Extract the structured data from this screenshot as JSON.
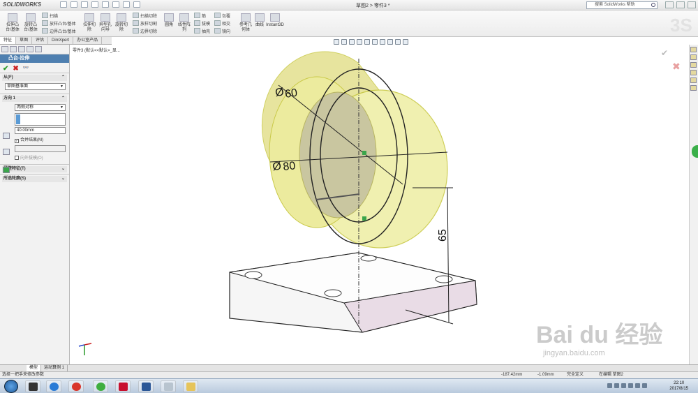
{
  "app": {
    "logo_brand": "SOLIDWORKS",
    "window_title": "草图2 > 零件3 *",
    "search_placeholder": "搜索 SolidWorks 帮助"
  },
  "ribbon": {
    "big_buttons": [
      {
        "label": "拉伸凸\n台/基体",
        "icon": "extrude-boss-icon"
      },
      {
        "label": "旋转凸\n台/基体",
        "icon": "revolve-boss-icon"
      },
      {
        "label": "拉伸切\n除",
        "icon": "extrude-cut-icon"
      },
      {
        "label": "异型孔\n向导",
        "icon": "hole-wizard-icon"
      },
      {
        "label": "旋转切\n除",
        "icon": "revolve-cut-icon"
      },
      {
        "label": "圆角",
        "icon": "fillet-icon"
      },
      {
        "label": "线性阵\n列",
        "icon": "linear-pattern-icon"
      },
      {
        "label": "参考几\n何体",
        "icon": "reference-geometry-icon"
      },
      {
        "label": "曲线",
        "icon": "curves-icon"
      },
      {
        "label": "Instant3D",
        "icon": "instant3d-icon"
      }
    ],
    "small_buttons": {
      "sweep": "扫描",
      "loft": "放样凸台/基体",
      "boundary": "边界凸台/基体",
      "sweep_cut": "扫描切除",
      "loft_cut": "放样切割",
      "boundary_cut": "边界切除",
      "rib": "筋",
      "draft": "拔模",
      "shell": "抽壳",
      "wrap": "包覆",
      "intersect": "相交",
      "mirror": "镜向"
    }
  },
  "tabs": [
    {
      "label": "特征",
      "active": true
    },
    {
      "label": "草图",
      "active": false
    },
    {
      "label": "评估",
      "active": false
    },
    {
      "label": "DimXpert",
      "active": false
    },
    {
      "label": "办公室产品",
      "active": false
    }
  ],
  "property_manager": {
    "title": "凸台-拉伸",
    "from": {
      "header": "从(F)",
      "value": "草图基准面"
    },
    "direction1": {
      "header": "方向 1",
      "end_condition": "两侧对称",
      "depth": "40.00mm",
      "merge_result": "合并结果(M)",
      "merge_checked": true,
      "draft_outward": "向外拔模(O)",
      "draft_checked": false
    },
    "thin_feature": {
      "header": "薄壁特征(T)",
      "checked": false
    },
    "selected_contours": {
      "header": "所选轮廓(S)"
    }
  },
  "breadcrumb": "零件3 (默认<<默认>_显...",
  "dimensions": {
    "inner_diameter": "60",
    "outer_diameter": "80",
    "height": "65"
  },
  "bottom_tabs": [
    {
      "label": "模型",
      "active": true
    },
    {
      "label": "运动算例 1",
      "active": false
    }
  ],
  "statusbar": {
    "hint": "选择一把手来修改参数",
    "x_coord": "-187.42mm",
    "y_coord": "-1.09mm",
    "state": "完全定义",
    "editing": "在编辑 草图2"
  },
  "taskbar": {
    "time": "22:10",
    "date": "2017/8/15"
  },
  "watermark": {
    "brand": "Bai du 经验",
    "url": "jingyan.baidu.com"
  }
}
